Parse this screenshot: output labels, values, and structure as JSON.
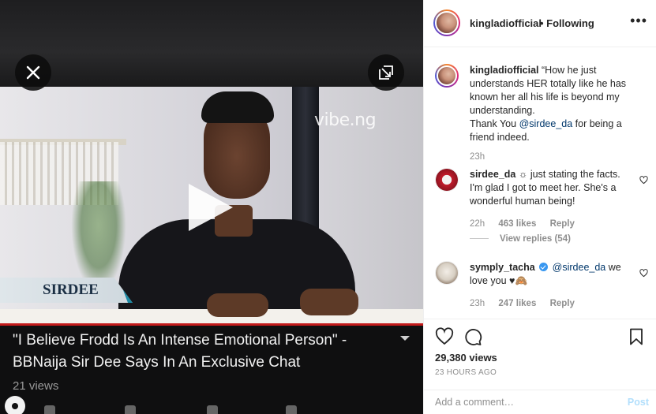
{
  "video": {
    "watermark": "vibe.ng",
    "name_tag": "SIRDEE",
    "title": "\"I Believe Frodd Is An Intense Emotional Person\" - BBNaija Sir Dee Says In An Exclusive Chat",
    "views": "21 views",
    "progress_color": "#c21a1a"
  },
  "post": {
    "header": {
      "username": "kingladiofficial",
      "following": "• Following",
      "more": "•••"
    },
    "caption": {
      "username": "kingladiofficial",
      "text_before": "“How he just understands HER totally like he has known her all his life is beyond my understanding.",
      "text_thanks": "Thank You",
      "mention": "@sirdee_da",
      "text_after": "for being a friend indeed.",
      "time": "23h"
    },
    "comments": [
      {
        "username": "sirdee_da",
        "text": "just stating the facts. I'm glad I got to meet her. She's a wonderful human being!",
        "time": "22h",
        "likes": "463 likes",
        "reply": "Reply",
        "view_replies": "View replies (54)"
      },
      {
        "username": "symply_tacha",
        "mention": "@sirdee_da",
        "text": "we love you ♥🙈",
        "time": "23h",
        "likes": "247 likes",
        "reply": "Reply"
      }
    ],
    "views": "29,380 views",
    "posted": "23 HOURS AGO",
    "add_comment_placeholder": "Add a comment…",
    "post_label": "Post"
  }
}
